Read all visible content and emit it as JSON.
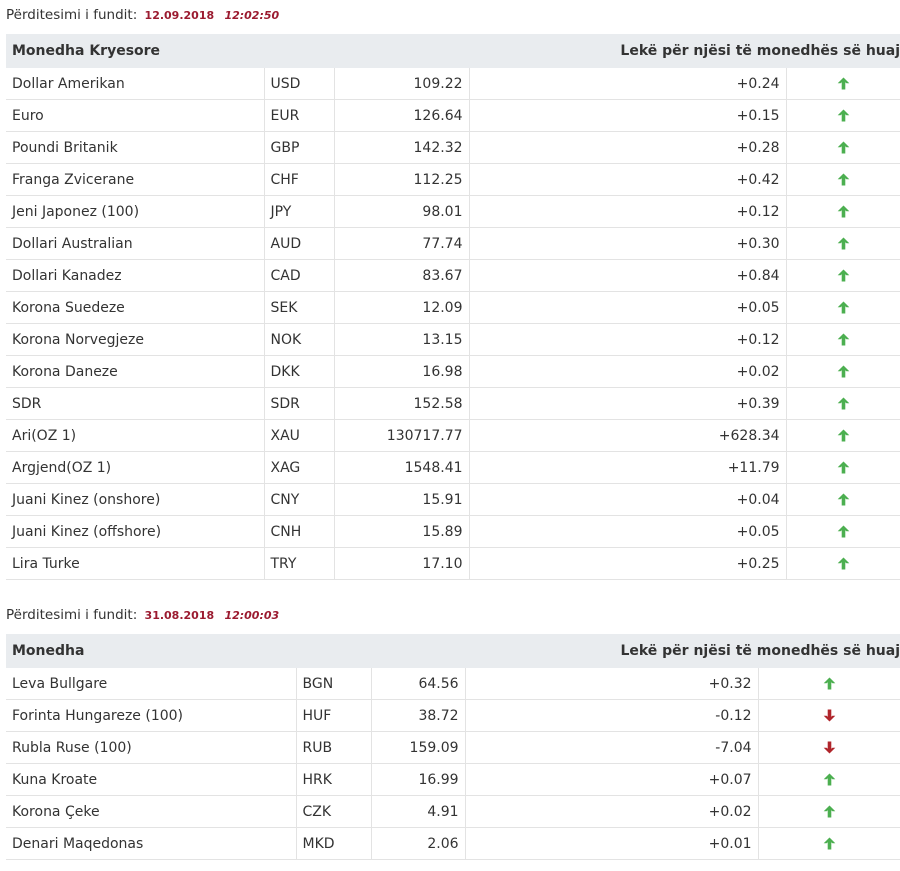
{
  "section1": {
    "update_label": "Përditesimi i fundit:",
    "date": "12.09.2018",
    "time": "12:02:50",
    "header_left": "Monedha Kryesore",
    "header_right": "Lekë për njësi të monedhës së huaj",
    "rows": [
      {
        "name": "Dollar Amerikan",
        "code": "USD",
        "rate": "109.22",
        "change": "+0.24",
        "trend": "up"
      },
      {
        "name": "Euro",
        "code": "EUR",
        "rate": "126.64",
        "change": "+0.15",
        "trend": "up"
      },
      {
        "name": "Poundi Britanik",
        "code": "GBP",
        "rate": "142.32",
        "change": "+0.28",
        "trend": "up"
      },
      {
        "name": "Franga Zvicerane",
        "code": "CHF",
        "rate": "112.25",
        "change": "+0.42",
        "trend": "up"
      },
      {
        "name": "Jeni Japonez (100)",
        "code": "JPY",
        "rate": "98.01",
        "change": "+0.12",
        "trend": "up"
      },
      {
        "name": "Dollari Australian",
        "code": "AUD",
        "rate": "77.74",
        "change": "+0.30",
        "trend": "up"
      },
      {
        "name": "Dollari Kanadez",
        "code": "CAD",
        "rate": "83.67",
        "change": "+0.84",
        "trend": "up"
      },
      {
        "name": "Korona Suedeze",
        "code": "SEK",
        "rate": "12.09",
        "change": "+0.05",
        "trend": "up"
      },
      {
        "name": "Korona Norvegjeze",
        "code": "NOK",
        "rate": "13.15",
        "change": "+0.12",
        "trend": "up"
      },
      {
        "name": "Korona Daneze",
        "code": "DKK",
        "rate": "16.98",
        "change": "+0.02",
        "trend": "up"
      },
      {
        "name": "SDR",
        "code": "SDR",
        "rate": "152.58",
        "change": "+0.39",
        "trend": "up"
      },
      {
        "name": "Ari(OZ 1)",
        "code": "XAU",
        "rate": "130717.77",
        "change": "+628.34",
        "trend": "up"
      },
      {
        "name": "Argjend(OZ 1)",
        "code": "XAG",
        "rate": "1548.41",
        "change": "+11.79",
        "trend": "up"
      },
      {
        "name": "Juani Kinez (onshore)",
        "code": "CNY",
        "rate": "15.91",
        "change": "+0.04",
        "trend": "up"
      },
      {
        "name": "Juani Kinez (offshore)",
        "code": "CNH",
        "rate": "15.89",
        "change": "+0.05",
        "trend": "up"
      },
      {
        "name": "Lira Turke",
        "code": "TRY",
        "rate": "17.10",
        "change": "+0.25",
        "trend": "up"
      }
    ]
  },
  "section2": {
    "update_label": "Përditesimi i fundit:",
    "date": "31.08.2018",
    "time": "12:00:03",
    "header_left": "Monedha",
    "header_right": "Lekë për njësi të monedhës së huaj",
    "rows": [
      {
        "name": "Leva Bullgare",
        "code": "BGN",
        "rate": "64.56",
        "change": "+0.32",
        "trend": "up"
      },
      {
        "name": "Forinta Hungareze (100)",
        "code": "HUF",
        "rate": "38.72",
        "change": "-0.12",
        "trend": "down"
      },
      {
        "name": "Rubla Ruse (100)",
        "code": "RUB",
        "rate": "159.09",
        "change": "-7.04",
        "trend": "down"
      },
      {
        "name": "Kuna Kroate",
        "code": "HRK",
        "rate": "16.99",
        "change": "+0.07",
        "trend": "up"
      },
      {
        "name": "Korona Çeke",
        "code": "CZK",
        "rate": "4.91",
        "change": "+0.02",
        "trend": "up"
      },
      {
        "name": "Denari Maqedonas",
        "code": "MKD",
        "rate": "2.06",
        "change": "+0.01",
        "trend": "up"
      }
    ]
  },
  "colors": {
    "up": "#4caf50",
    "down": "#b0252b",
    "header_bg": "#e9ecef",
    "date_red": "#9b1b30"
  },
  "icons": {
    "up": "arrow-up-icon",
    "down": "arrow-down-icon"
  }
}
